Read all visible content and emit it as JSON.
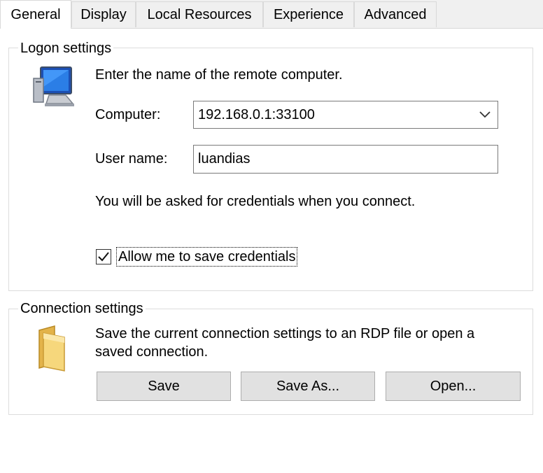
{
  "tabs": [
    {
      "label": "General",
      "active": true
    },
    {
      "label": "Display",
      "active": false
    },
    {
      "label": "Local Resources",
      "active": false
    },
    {
      "label": "Experience",
      "active": false
    },
    {
      "label": "Advanced",
      "active": false
    }
  ],
  "logon": {
    "legend": "Logon settings",
    "computer_icon": "remote-computer-icon",
    "instruction": "Enter the name of the remote computer.",
    "computer_label": "Computer:",
    "computer_value": "192.168.0.1:33100",
    "username_label": "User name:",
    "username_value": "luandias",
    "credentials_note": "You will be asked for credentials when you connect.",
    "save_credentials_label": "Allow me to save credentials",
    "save_credentials_checked": true
  },
  "connection": {
    "legend": "Connection settings",
    "folder_icon": "folder-icon",
    "description_line1": "Save the current connection settings to an RDP file or open a",
    "description_line2": "saved connection.",
    "save_label": "Save",
    "save_as_label": "Save As...",
    "open_label": "Open..."
  }
}
